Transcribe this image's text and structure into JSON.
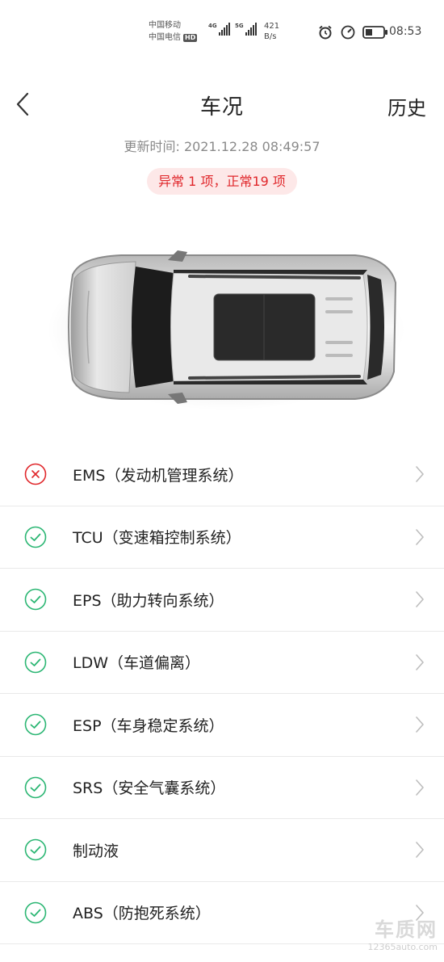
{
  "status_bar": {
    "carrier_1": "中国移动",
    "carrier_2": "中国电信",
    "hd_badge": "HD",
    "sig1_label": "4G",
    "sig2_label": "5G",
    "speed_value": "421",
    "speed_unit": "B/s",
    "time": "08:53",
    "icons": [
      "alarm-icon",
      "gauge-icon",
      "battery-icon"
    ]
  },
  "header": {
    "title": "车况",
    "history_label": "历史"
  },
  "update_time": "更新时间: 2021.12.28 08:49:57",
  "summary_pill": "异常 1 项，正常19 项",
  "colors": {
    "abnormal": "#e0272b",
    "normal": "#2bb673",
    "pill_bg": "#fde8e8"
  },
  "items": [
    {
      "label": "EMS（发动机管理系统）",
      "status": "abnormal"
    },
    {
      "label": "TCU（变速箱控制系统）",
      "status": "normal"
    },
    {
      "label": "EPS（助力转向系统）",
      "status": "normal"
    },
    {
      "label": "LDW（车道偏离）",
      "status": "normal"
    },
    {
      "label": "ESP（车身稳定系统）",
      "status": "normal"
    },
    {
      "label": "SRS（安全气囊系统）",
      "status": "normal"
    },
    {
      "label": "制动液",
      "status": "normal"
    },
    {
      "label": "ABS（防抱死系统）",
      "status": "normal"
    }
  ],
  "watermark": {
    "brand": "车质网",
    "url": "12365auto.com"
  }
}
